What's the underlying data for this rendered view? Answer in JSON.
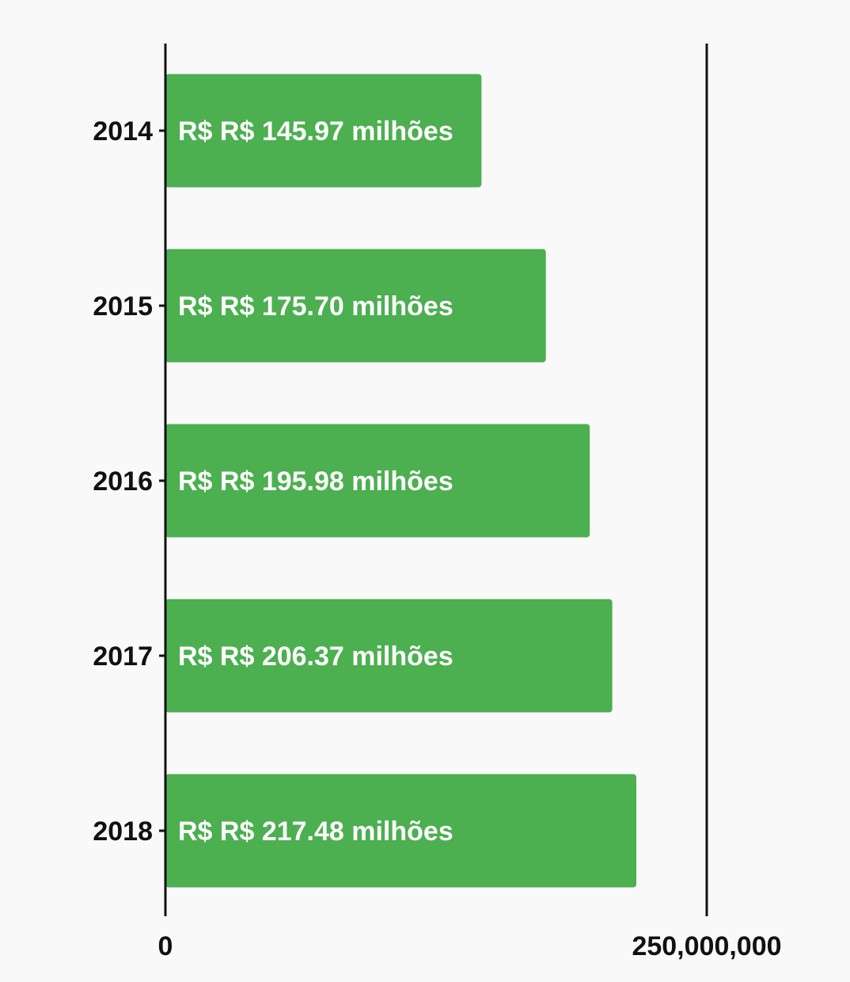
{
  "chart_data": {
    "type": "bar",
    "orientation": "horizontal",
    "categories": [
      "2014",
      "2015",
      "2016",
      "2017",
      "2018"
    ],
    "values": [
      145970000,
      175700000,
      195980000,
      206370000,
      217480000
    ],
    "data_labels": [
      "R$ R$ 145.97 milhões",
      "R$ R$ 175.70 milhões",
      "R$ R$ 195.98 milhões",
      "R$ R$ 206.37 milhões",
      "R$ R$ 217.48 milhões"
    ],
    "xlim": [
      0,
      250000000
    ],
    "x_ticks": [
      0,
      250000000
    ],
    "x_tick_labels": [
      "0",
      "250,000,000"
    ],
    "title": "",
    "xlabel": "",
    "ylabel": "",
    "grid": false,
    "colors": {
      "bar": "#4caf50",
      "axis": "#111111",
      "background": "#f9f9f9",
      "label": "#ffffff"
    }
  }
}
